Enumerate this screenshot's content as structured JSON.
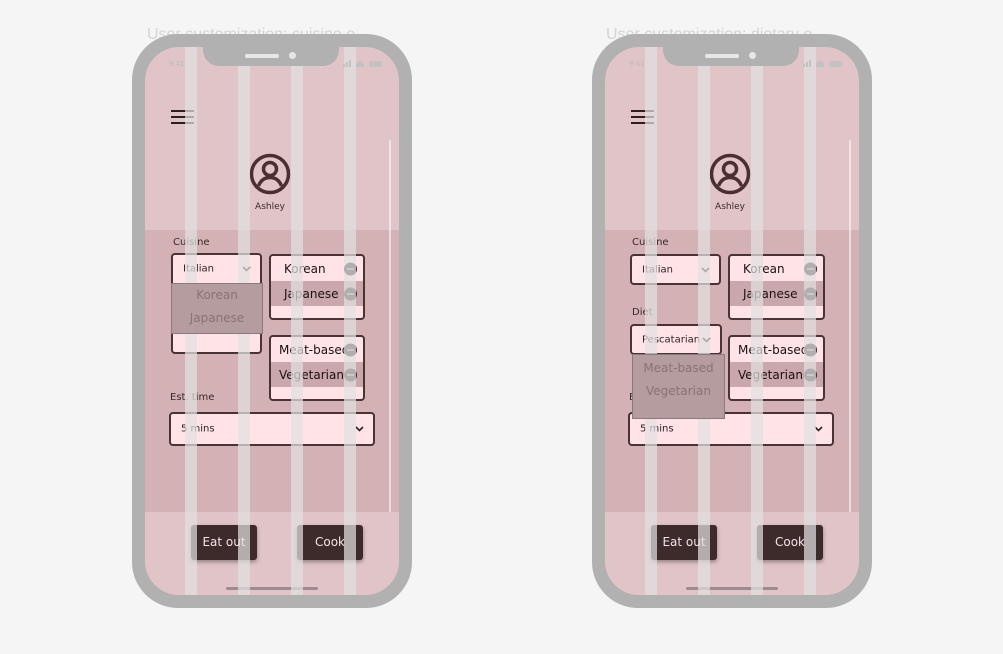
{
  "screens": [
    {
      "caption": "User customization: cuisine o...",
      "status_time": "9:41",
      "user": {
        "name": "Ashley"
      },
      "cuisine": {
        "label": "Cuisine",
        "selected": "Italian",
        "dropdown_open": true,
        "dropdown_options": [
          "Korean",
          "Japanese"
        ],
        "chips": [
          "Korean",
          "Japanese"
        ]
      },
      "diet": {
        "label": "",
        "selected": "",
        "dropdown_open": false,
        "dropdown_options": [],
        "chips": [
          "Meat-based",
          "Vegetarian"
        ]
      },
      "time": {
        "label": "Est. time",
        "selected": "5 mins"
      },
      "buttons": {
        "eat_out": "Eat out",
        "cook": "Cook"
      }
    },
    {
      "caption": "User customization: dietary o...",
      "status_time": "9:41",
      "user": {
        "name": "Ashley"
      },
      "cuisine": {
        "label": "Cuisine",
        "selected": "Italian",
        "dropdown_open": false,
        "dropdown_options": [],
        "chips": [
          "Korean",
          "Japanese"
        ]
      },
      "diet": {
        "label": "Diet",
        "selected": "Pescatarian",
        "dropdown_open": true,
        "dropdown_options": [
          "Meat-based",
          "Vegetarian"
        ],
        "chips": [
          "Meat-based",
          "Vegetarian"
        ]
      },
      "time": {
        "label": "E",
        "selected": "5 mins"
      },
      "buttons": {
        "eat_out": "Eat out",
        "cook": "Cook"
      }
    }
  ],
  "colors": {
    "screen_bg": "#e1c4c7",
    "content_bg": "#d3b1b4",
    "field_bg": "#ffe3e6",
    "border": "#4a3334",
    "button_bg": "#3d2a2b",
    "device_frame": "#b1b1b1",
    "page_bg": "#f5f5f5"
  },
  "icons": {
    "menu": "hamburger-icon",
    "profile": "user-circle-icon",
    "dropdown": "chevron-down-icon",
    "remove": "minus-circle-icon"
  }
}
